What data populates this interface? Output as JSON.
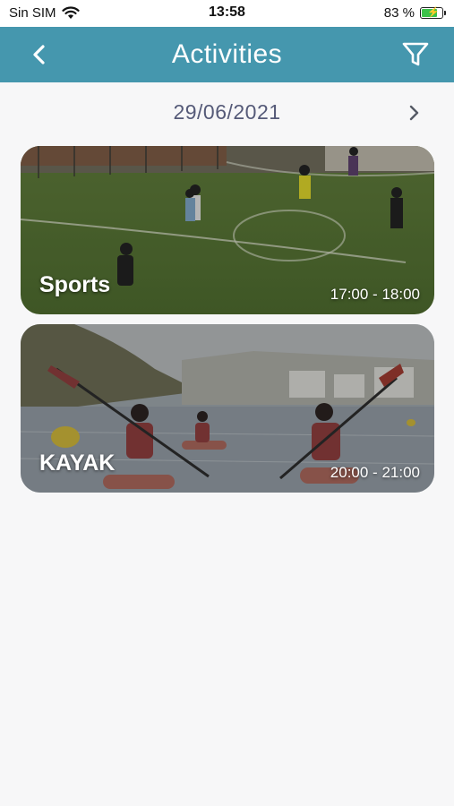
{
  "status_bar": {
    "carrier": "Sin SIM",
    "time": "13:58",
    "battery_percent": "83 %",
    "battery_level": 0.83,
    "battery_color": "#3cc34a"
  },
  "header": {
    "title": "Activities",
    "back_icon": "chevron-left-icon",
    "filter_icon": "filter-icon",
    "color": "#4597ae"
  },
  "date_nav": {
    "date": "29/06/2021",
    "next_icon": "chevron-right-icon"
  },
  "activities": [
    {
      "name": "Sports",
      "time": "17:00 - 18:00"
    },
    {
      "name": "KAYAK",
      "time": "20:00 - 21:00"
    }
  ]
}
